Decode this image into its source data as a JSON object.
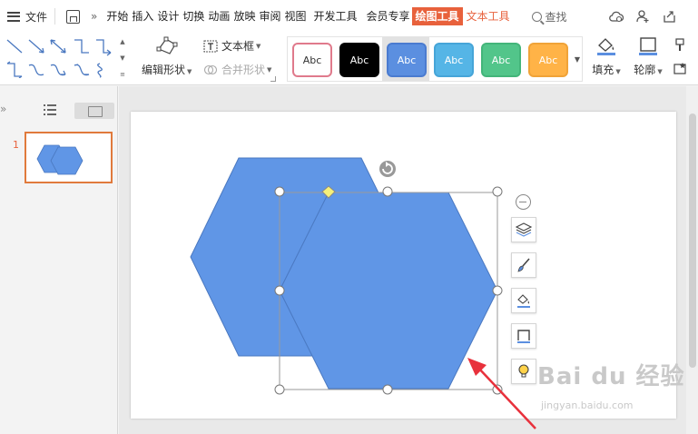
{
  "menubar": {
    "file_label": "文件",
    "tabs": [
      {
        "label": "开始"
      },
      {
        "label": "插入"
      },
      {
        "label": "设计"
      },
      {
        "label": "切换"
      },
      {
        "label": "动画"
      },
      {
        "label": "放映"
      },
      {
        "label": "审阅"
      },
      {
        "label": "视图"
      },
      {
        "label": "开发工具"
      },
      {
        "label": "会员专享"
      },
      {
        "label": "绘图工具"
      },
      {
        "label": "文本工具"
      }
    ],
    "active_tab": "绘图工具",
    "search_label": "查找",
    "right_icons": [
      "cloud-icon",
      "add-user-icon",
      "share-icon"
    ]
  },
  "ribbon": {
    "edit_shape_label": "编辑形状",
    "textbox_label": "文本框",
    "merge_shapes_label": "合并形状",
    "styles": [
      {
        "label": "Abc",
        "bg": "#ffffff",
        "border": "#e07a8c",
        "text": "#333333"
      },
      {
        "label": "Abc",
        "bg": "#000000",
        "border": "#000000",
        "text": "#ffffff"
      },
      {
        "label": "Abc",
        "bg": "#5b8fe0",
        "border": "#4a7bd0",
        "text": "#ffffff"
      },
      {
        "label": "Abc",
        "bg": "#55b5e6",
        "border": "#46a5d8",
        "text": "#ffffff"
      },
      {
        "label": "Abc",
        "bg": "#52c58a",
        "border": "#43b57a",
        "text": "#ffffff"
      },
      {
        "label": "Abc",
        "bg": "#ffb347",
        "border": "#f0a338",
        "text": "#ffffff"
      }
    ],
    "fill_label": "填充",
    "outline_label": "轮廓"
  },
  "thumbnail_pane": {
    "slide_number": "1"
  },
  "colors": {
    "hexagon_fill": "#6096e6",
    "hexagon_stroke": "#4a78c0",
    "accent": "#e8613c",
    "arrow": "#e8313c"
  },
  "float_toolbar": {
    "buttons": [
      "layers-icon",
      "brush-icon",
      "fill-bucket-icon",
      "outline-frame-icon",
      "lightbulb-icon"
    ]
  },
  "watermark": {
    "logo": "Bai du 经验",
    "url": "jingyan.baidu.com"
  }
}
